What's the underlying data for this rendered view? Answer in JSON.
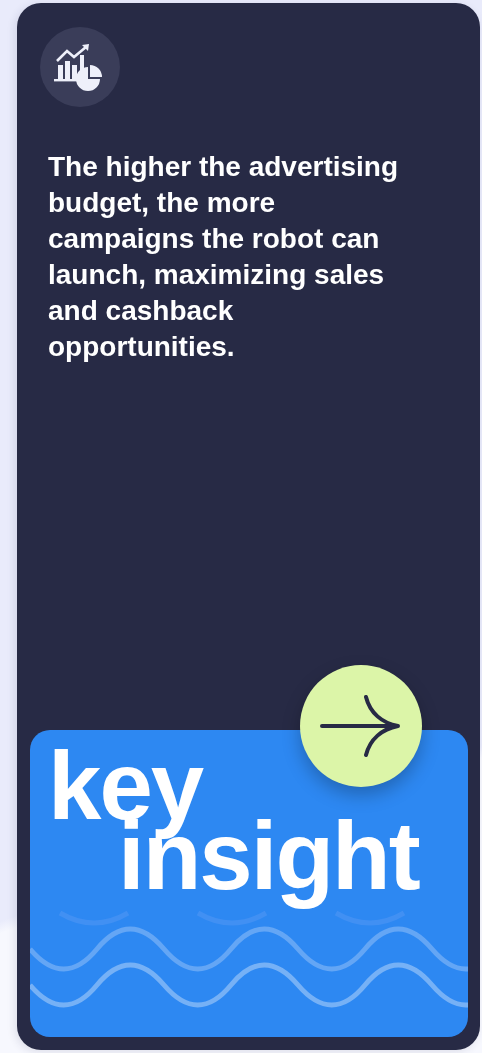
{
  "card": {
    "description": "The higher the advertising budget, the more campaigns the robot can launch, maximizing sales and cashback opportunities.",
    "banner": {
      "title_lines": [
        "key",
        "insight"
      ]
    }
  }
}
